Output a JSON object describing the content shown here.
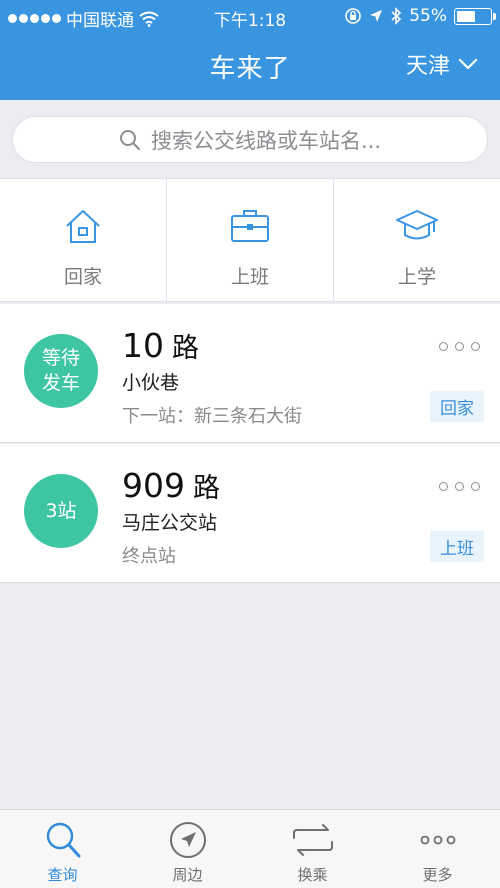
{
  "status_bar": {
    "carrier": "中国联通",
    "time": "下午1:18",
    "battery_text": "55%",
    "battery_level": 0.55
  },
  "header": {
    "title": "车来了",
    "city": "天津"
  },
  "search": {
    "placeholder": "搜索公交线路或车站名..."
  },
  "shortcuts": [
    {
      "label": "回家",
      "icon": "home-icon"
    },
    {
      "label": "上班",
      "icon": "briefcase-icon"
    },
    {
      "label": "上学",
      "icon": "graduation-cap-icon"
    }
  ],
  "cards": [
    {
      "status_line1": "等待",
      "status_line2": "发车",
      "route_number": "10",
      "route_suffix": "路",
      "station": "小伙巷",
      "next_stop": "下一站：新三条石大街",
      "tag": "回家"
    },
    {
      "status_line1": "3站",
      "status_line2": "",
      "route_number": "909",
      "route_suffix": "路",
      "station": "马庄公交站",
      "next_stop": "终点站",
      "tag": "上班"
    }
  ],
  "tabs": [
    {
      "label": "查询",
      "icon": "search-icon",
      "active": true
    },
    {
      "label": "周边",
      "icon": "navigation-icon",
      "active": false
    },
    {
      "label": "换乘",
      "icon": "transfer-icon",
      "active": false
    },
    {
      "label": "更多",
      "icon": "more-icon",
      "active": false
    }
  ],
  "colors": {
    "brand_blue": "#3a95e0",
    "status_green": "#3ec6a3",
    "tag_blue": "#3a8fdc"
  }
}
